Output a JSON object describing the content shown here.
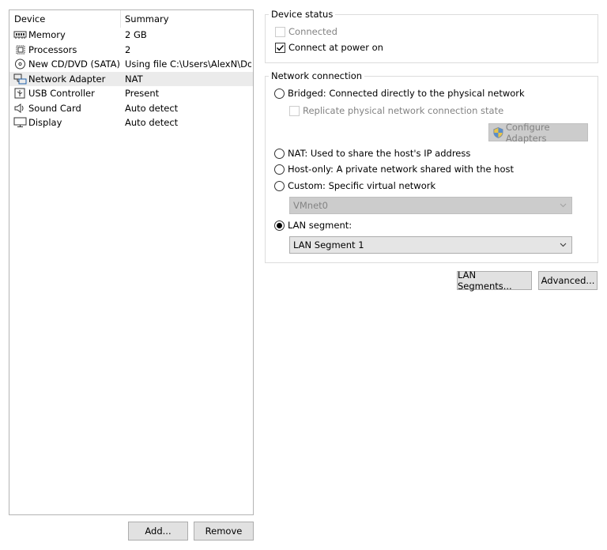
{
  "device_list": {
    "headers": {
      "device": "Device",
      "summary": "Summary"
    },
    "rows": [
      {
        "name": "Memory",
        "summary": "2 GB",
        "icon": "memory-icon"
      },
      {
        "name": "Processors",
        "summary": "2",
        "icon": "processor-icon"
      },
      {
        "name": "New CD/DVD (SATA)",
        "summary": "Using file C:\\Users\\AlexN\\Do...",
        "icon": "cd-dvd-icon"
      },
      {
        "name": "Network Adapter",
        "summary": "NAT",
        "icon": "network-adapter-icon",
        "selected": true
      },
      {
        "name": "USB Controller",
        "summary": "Present",
        "icon": "usb-icon"
      },
      {
        "name": "Sound Card",
        "summary": "Auto detect",
        "icon": "speaker-icon"
      },
      {
        "name": "Display",
        "summary": "Auto detect",
        "icon": "display-icon"
      }
    ],
    "add_label": "Add...",
    "remove_label": "Remove"
  },
  "device_status": {
    "title": "Device status",
    "connected_label": "Connected",
    "connected_checked": false,
    "connected_enabled": false,
    "power_on_label": "Connect at power on",
    "power_on_checked": true
  },
  "network_connection": {
    "title": "Network connection",
    "bridged_label": "Bridged: Connected directly to the physical network",
    "replicate_label": "Replicate physical network connection state",
    "configure_label": "Configure Adapters",
    "nat_label": "NAT: Used to share the host's IP address",
    "hostonly_label": "Host-only: A private network shared with the host",
    "custom_label": "Custom: Specific virtual network",
    "custom_value": "VMnet0",
    "lan_label": "LAN segment:",
    "lan_value": "LAN Segment 1",
    "selected_option": "lan"
  },
  "buttons": {
    "lan_segments_label": "LAN Segments...",
    "advanced_label": "Advanced..."
  }
}
